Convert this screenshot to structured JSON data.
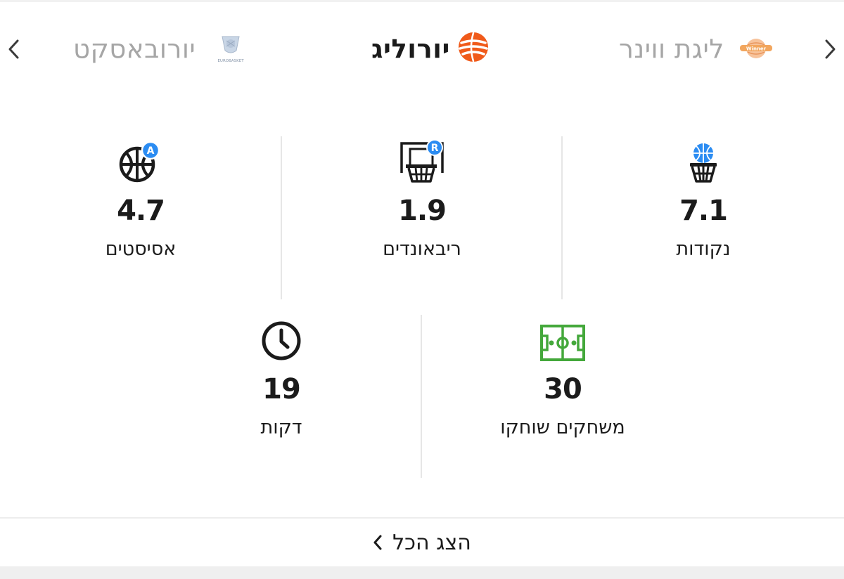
{
  "switcher": {
    "leagues": [
      {
        "name": "יורובאסקט",
        "logo": "eurobasket-logo",
        "logo_text": "EUROBASKET",
        "state": "inactive"
      },
      {
        "name": "יורוליג",
        "logo": "euroleague-logo",
        "state": "active"
      },
      {
        "name": "ליגת ווינר",
        "logo": "winner-league-logo",
        "state": "inactive"
      }
    ]
  },
  "stats": {
    "points": {
      "value": "7.1",
      "label": "נקודות",
      "icon": "basket-icon"
    },
    "rebounds": {
      "value": "1.9",
      "label": "ריבאונדים",
      "icon": "rebound-icon",
      "badge": "R"
    },
    "assists": {
      "value": "4.7",
      "label": "אסיסטים",
      "icon": "assist-ball-icon",
      "badge": "A"
    },
    "games": {
      "value": "30",
      "label": "משחקים שוחקו",
      "icon": "court-icon"
    },
    "minutes": {
      "value": "19",
      "label": "דקות",
      "icon": "clock-icon"
    }
  },
  "footer": {
    "show_all_label": "הצג הכל"
  },
  "colors": {
    "accent_blue": "#2b8cf2",
    "euroleague_orange": "#f05a1a",
    "court_green": "#44a83b",
    "inactive_text": "#a6a6a6",
    "divider": "#e6e6e6"
  }
}
